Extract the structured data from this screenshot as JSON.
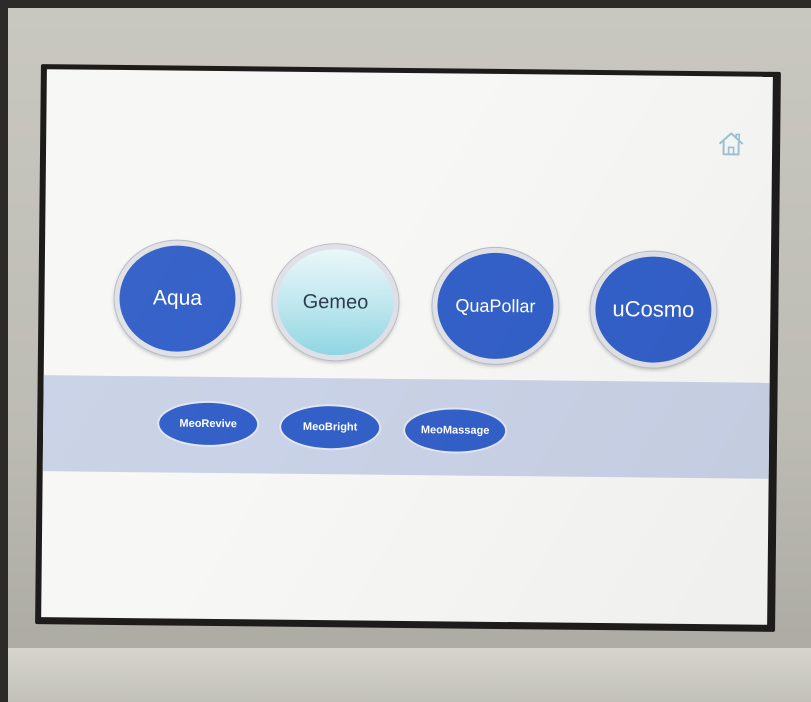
{
  "main_modes": [
    {
      "label": "Aqua",
      "selected": false
    },
    {
      "label": "Gemeo",
      "selected": true
    },
    {
      "label": "QuaPollar",
      "selected": false
    },
    {
      "label": "uCosmo",
      "selected": false
    }
  ],
  "sub_modes": [
    {
      "label": "MeoRevive"
    },
    {
      "label": "MeoBright"
    },
    {
      "label": "MeoMassage"
    }
  ],
  "icons": {
    "home": "home-icon"
  },
  "colors": {
    "button_blue": "#3360c8",
    "selected_button": "#bde6ee",
    "sub_band": "#c9d2e6",
    "screen_background": "#f7f7f5",
    "bezel": "#c9c8c0"
  }
}
